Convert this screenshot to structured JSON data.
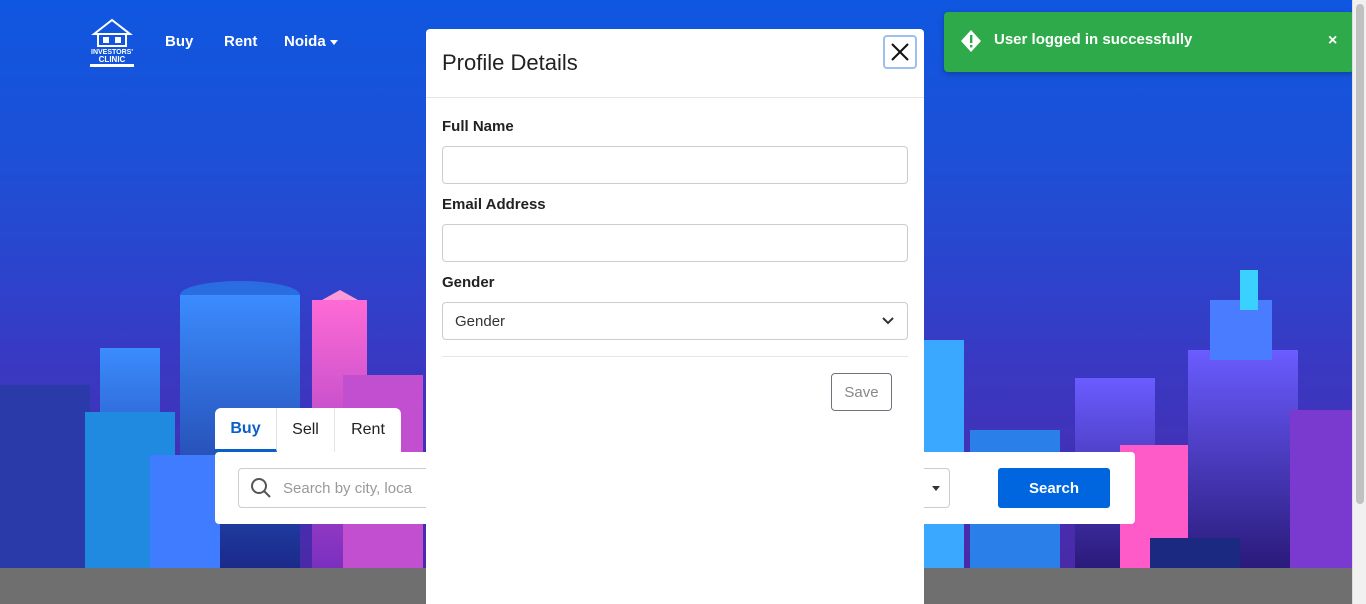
{
  "nav": {
    "logo_text": "INVESTORS' CLINIC",
    "links": [
      {
        "label": "Buy"
      },
      {
        "label": "Rent"
      },
      {
        "label": "Noida"
      }
    ]
  },
  "search": {
    "tabs": [
      {
        "label": "Buy",
        "active": true
      },
      {
        "label": "Sell",
        "active": false
      },
      {
        "label": "Rent",
        "active": false
      }
    ],
    "placeholder": "Search by city, loca",
    "button_label": "Search",
    "accent_color": "#0066e0"
  },
  "modal": {
    "title": "Profile Details",
    "fields": {
      "full_name": {
        "label": "Full Name",
        "value": ""
      },
      "email": {
        "label": "Email Address",
        "value": ""
      },
      "gender": {
        "label": "Gender",
        "selected": "Gender"
      }
    },
    "save_label": "Save"
  },
  "toast": {
    "message": "User logged in successfully",
    "close_glyph": "×",
    "color": "#2eaa4a"
  }
}
